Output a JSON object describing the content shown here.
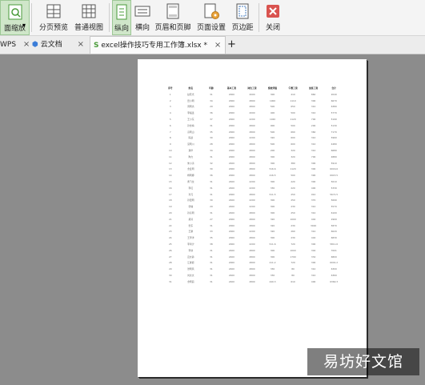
{
  "toolbar": {
    "page_zoom_label": "面缩放",
    "page_break_preview_label": "分页预览",
    "normal_view_label": "普通视图",
    "portrait_label": "纵向",
    "landscape_label": "横向",
    "header_footer_label": "页眉和页脚",
    "page_setup_label": "页面设置",
    "margins_label": "页边距",
    "close_label": "关闭"
  },
  "tabs": [
    {
      "label": "WPS",
      "close": "×"
    },
    {
      "label": "云文档",
      "close": "×"
    },
    {
      "label": "excel操作技巧专用工作簿.xlsx *",
      "close": "×"
    }
  ],
  "new_tab_symbol": "+",
  "colors": {
    "accent": "#4a9b3a",
    "close_red": "#d9534f",
    "workspace": "#8c8c8c"
  },
  "sheet": {
    "headers": [
      "序号",
      "姓名",
      "年龄",
      "基本工资",
      "岗位工资",
      "绩效评级",
      "午餐工资",
      "加班工资",
      "合计"
    ],
    "rows": [
      [
        "1",
        "赵晓光",
        "31",
        "2000",
        "2000",
        "300",
        "410",
        "860",
        "2040"
      ],
      [
        "2",
        "田小明",
        "34",
        "2000",
        "2800",
        "1000",
        "1110",
        "300",
        "6670"
      ],
      [
        "3",
        "周明杰",
        "29",
        "2000",
        "2800",
        "500",
        "650",
        "310",
        "6380"
      ],
      [
        "4",
        "李福连",
        "36",
        "2000",
        "2000",
        "400",
        "500",
        "310",
        "5770"
      ],
      [
        "5",
        "王小东",
        "37",
        "2000",
        "2200",
        "1020",
        "1120",
        "700",
        "5190"
      ],
      [
        "6",
        "孙金梅",
        "31",
        "2000",
        "2800",
        "900",
        "500",
        "200",
        "5130"
      ],
      [
        "7",
        "高明山",
        "35",
        "2000",
        "2800",
        "500",
        "660",
        "360",
        "7170"
      ],
      [
        "8",
        "陈晨",
        "30",
        "2000",
        "2200",
        "320",
        "600",
        "310",
        "5960"
      ],
      [
        "9",
        "吴明川",
        "28",
        "2000",
        "2800",
        "500",
        "600",
        "310",
        "4480"
      ],
      [
        "10",
        "潘华",
        "34",
        "2000",
        "2800",
        "200",
        "320",
        "310",
        "6680"
      ],
      [
        "11",
        "陶力",
        "31",
        "2000",
        "2800",
        "300",
        "320",
        "700",
        "4880"
      ],
      [
        "12",
        "朱小涛",
        "32",
        "2400",
        "2800",
        "300",
        "380",
        "300",
        "5910"
      ],
      [
        "13",
        "金爱明",
        "30",
        "2000",
        "2800",
        "516.6",
        "1120",
        "300",
        "6016.6"
      ],
      [
        "14",
        "杨明娜",
        "36",
        "2000",
        "2800",
        "216.5",
        "500",
        "390",
        "6915.5"
      ],
      [
        "15",
        "曹飞龙",
        "31",
        "2400",
        "2200",
        "300",
        "220",
        "300",
        "5010"
      ],
      [
        "16",
        "李红",
        "31",
        "2400",
        "2200",
        "330",
        "220",
        "400",
        "5330"
      ],
      [
        "17",
        "孙元",
        "31",
        "2000",
        "2800",
        "511.5",
        "250",
        "910",
        "5671.5"
      ],
      [
        "18",
        "孙更明",
        "30",
        "2400",
        "2200",
        "300",
        "250",
        "370",
        "5690"
      ],
      [
        "19",
        "张敏",
        "29",
        "2400",
        "2200",
        "300",
        "230",
        "310",
        "5570"
      ],
      [
        "20",
        "孙高明",
        "31",
        "2400",
        "2800",
        "300",
        "250",
        "310",
        "6100"
      ],
      [
        "21",
        "郑涛",
        "27",
        "2000",
        "2800",
        "320",
        "1000",
        "402",
        "2900"
      ],
      [
        "22",
        "张东",
        "31",
        "2000",
        "2800",
        "320",
        "230",
        "3020",
        "5870"
      ],
      [
        "23",
        "王鹏",
        "33",
        "2000",
        "2200",
        "320",
        "260",
        "310",
        "6020"
      ],
      [
        "24",
        "王泽洋",
        "35",
        "2000",
        "2800",
        "300",
        "230",
        "402",
        "6830"
      ],
      [
        "25",
        "李禹汐",
        "38",
        "2000",
        "2200",
        "511.6",
        "720",
        "300",
        "5811.6"
      ],
      [
        "26",
        "李鲜",
        "31",
        "2400",
        "2800",
        "300",
        "1000",
        "302",
        "7001"
      ],
      [
        "27",
        "吕文静",
        "31",
        "2400",
        "2800",
        "300",
        "1790",
        "332",
        "6800"
      ],
      [
        "28",
        "江继郎",
        "31",
        "2000",
        "2800",
        "211.2",
        "720",
        "300",
        "6001.2"
      ],
      [
        "29",
        "张明风",
        "31",
        "2400",
        "2800",
        "330",
        "80",
        "310",
        "6300"
      ],
      [
        "30",
        "刘文文",
        "31",
        "2400",
        "2800",
        "330",
        "80",
        "310",
        "6360"
      ],
      [
        "31",
        "金明丽",
        "31",
        "2400",
        "2800",
        "440.3",
        "610",
        "400",
        "6360.3"
      ]
    ]
  },
  "watermark_text": "易坊好文馆"
}
